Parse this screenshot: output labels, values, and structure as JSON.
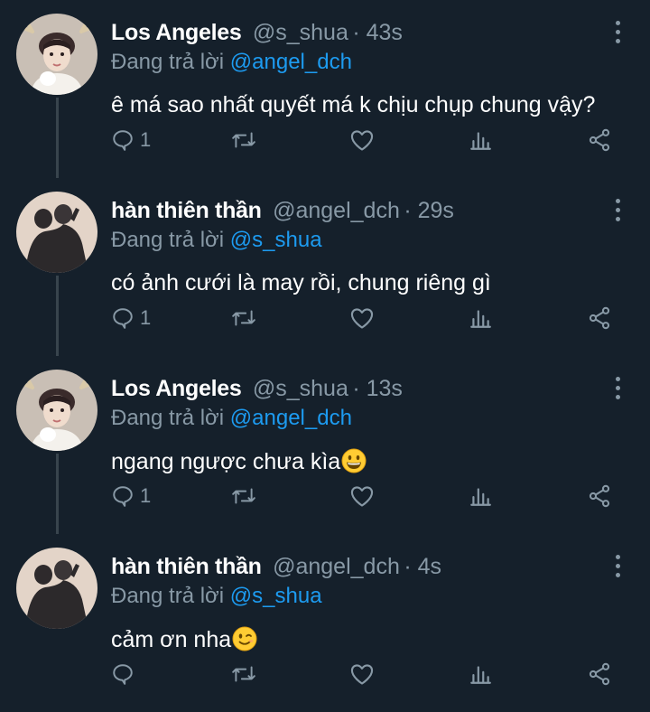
{
  "tweets": [
    {
      "name": "Los Angeles",
      "handle": "@s_shua",
      "time": "43s",
      "reply_prefix": "Đang trả lời",
      "reply_to": "@angel_dch",
      "text": "ê má sao nhất quyết má k chịu chụp chung vậy?",
      "reply_count": "1",
      "avatar": "boy-with-antlers-avatar"
    },
    {
      "name": "hàn thiên thần",
      "handle": "@angel_dch",
      "time": "29s",
      "reply_prefix": "Đang trả lời",
      "reply_to": "@s_shua",
      "text": "có ảnh cưới là may rồi, chung riêng gì",
      "reply_count": "1",
      "avatar": "couple-shadow-avatar"
    },
    {
      "name": "Los Angeles",
      "handle": "@s_shua",
      "time": "13s",
      "reply_prefix": "Đang trả lời",
      "reply_to": "@angel_dch",
      "text": "ngang ngược chưa kìa",
      "emoji": "grinning-face",
      "reply_count": "1",
      "avatar": "boy-with-antlers-avatar"
    },
    {
      "name": "hàn thiên thần",
      "handle": "@angel_dch",
      "time": "4s",
      "reply_prefix": "Đang trả lời",
      "reply_to": "@s_shua",
      "text": "cảm ơn nha",
      "emoji": "winking-face",
      "reply_count": "",
      "avatar": "couple-shadow-avatar"
    }
  ],
  "separator": "·",
  "icons": [
    "reply-icon",
    "retweet-icon",
    "like-icon",
    "analytics-icon",
    "share-icon",
    "more-icon"
  ],
  "colors": {
    "background": "#15202b",
    "secondary_text": "#8899a6",
    "mention": "#1d9bf0",
    "thread_line": "#38444d"
  }
}
